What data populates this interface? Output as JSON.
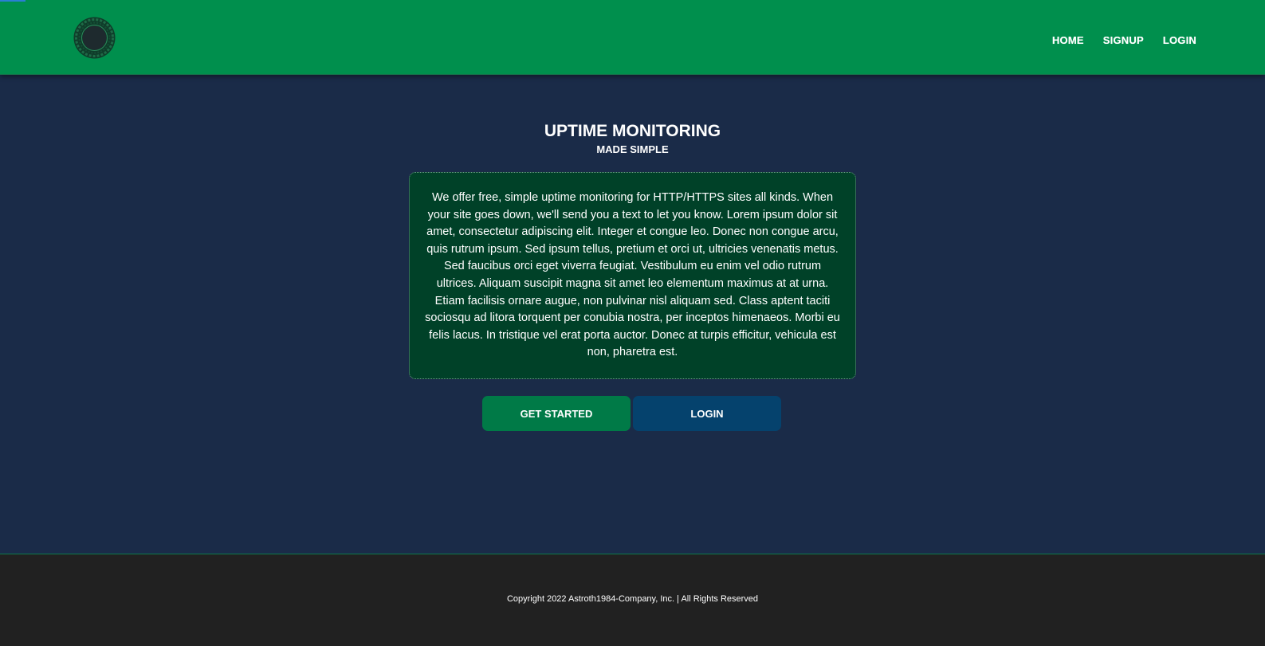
{
  "colors": {
    "header": "#008f4d",
    "page_background": "#1a2b48",
    "card_background": "#004128",
    "primary_button": "#007a47",
    "secondary_button": "#05426d",
    "footer": "#212121"
  },
  "header": {
    "logo_icon": "circular-gear-logo-icon",
    "nav": [
      {
        "label": "HOME"
      },
      {
        "label": "SIGNUP"
      },
      {
        "label": "LOGIN"
      }
    ]
  },
  "hero": {
    "title": "UPTIME MONITORING",
    "subtitle": "MADE SIMPLE",
    "description": "We offer free, simple uptime monitoring for HTTP/HTTPS sites all kinds. When your site goes down, we'll send you a text to let you know. Lorem ipsum dolor sit amet, consectetur adipiscing elit. Integer et congue leo. Donec non congue arcu, quis rutrum ipsum. Sed ipsum tellus, pretium et orci ut, ultricies venenatis metus. Sed faucibus orci eget viverra feugiat. Vestibulum eu enim vel odio rutrum ultrices. Aliquam suscipit magna sit amet leo elementum maximus at at urna. Etiam facilisis ornare augue, non pulvinar nisl aliquam sed. Class aptent taciti sociosqu ad litora torquent per conubia nostra, per inceptos himenaeos. Morbi eu felis lacus. In tristique vel erat porta auctor. Donec at turpis efficitur, vehicula est non, pharetra est."
  },
  "actions": {
    "get_started_label": "GET STARTED",
    "login_label": "LOGIN"
  },
  "footer": {
    "copyright": "Copyright 2022 Astroth1984-Company, Inc. | All Rights Reserved"
  }
}
